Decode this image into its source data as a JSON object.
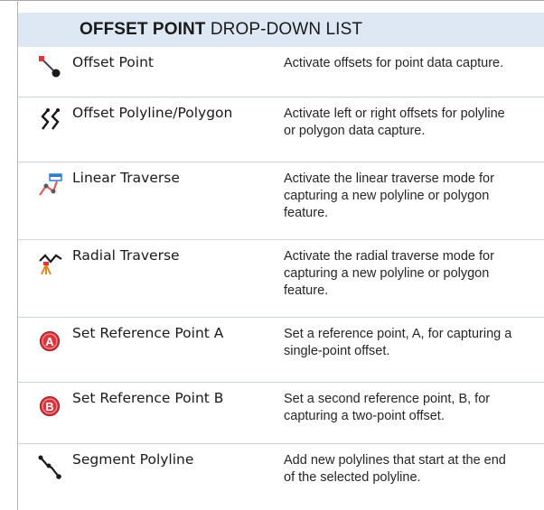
{
  "header": {
    "title_bold": "OFFSET POINT",
    "title_rest": " DROP-DOWN LIST"
  },
  "rows": [
    {
      "icon": "offset-point-icon",
      "name": "Offset Point",
      "desc": [
        "Activate offsets for point data capture."
      ]
    },
    {
      "icon": "offset-polyline-polygon-icon",
      "name": "Offset Polyline/Polygon",
      "desc": [
        "Activate left or right offsets for polyline",
        "or polygon data capture."
      ]
    },
    {
      "icon": "linear-traverse-icon",
      "name": "Linear Traverse",
      "desc": [
        "Activate the linear traverse mode for",
        "capturing a new polyline or polygon",
        "feature."
      ]
    },
    {
      "icon": "radial-traverse-icon",
      "name": "Radial Traverse",
      "desc": [
        "Activate the radial traverse mode for",
        "capturing a new polyline or polygon",
        "feature."
      ]
    },
    {
      "icon": "reference-point-a-icon",
      "name": "Set Reference Point A",
      "badge": "A",
      "desc": [
        "Set a reference point, A, for capturing a",
        "single-point offset."
      ]
    },
    {
      "icon": "reference-point-b-icon",
      "name": "Set Reference Point B",
      "badge": "B",
      "desc": [
        "Set a second reference point, B, for",
        "capturing a two-point offset."
      ]
    },
    {
      "icon": "segment-polyline-icon",
      "name": "Segment Polyline",
      "desc": [
        "Add new polylines that start at the end",
        "of the selected polyline."
      ]
    }
  ],
  "colors": {
    "header_bg": "#dde8f4",
    "badge_red": "#d9363e",
    "accent_blue": "#2f7fd1",
    "separator": "#c9d6e6"
  }
}
